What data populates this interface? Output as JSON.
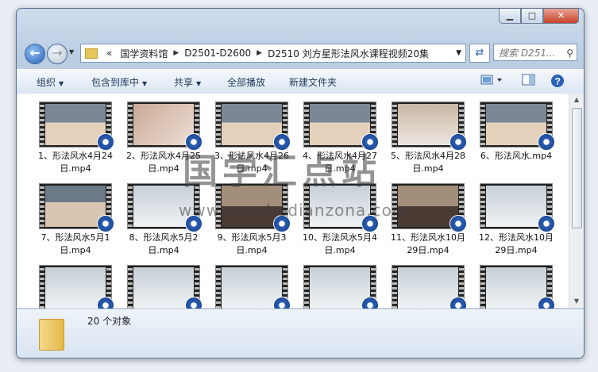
{
  "window": {
    "caption": {
      "minimize": "▁",
      "maximize": "□",
      "close": "✕"
    }
  },
  "address": {
    "prefix": "«",
    "crumbs": [
      "国学资料馆",
      "D2501-D2600",
      "D2510 刘方星形法风水课程视频20集"
    ],
    "search_placeholder": "搜索 D251..."
  },
  "toolbar": {
    "organize": "组织",
    "include_library": "包含到库中",
    "share": "共享",
    "play_all": "全部播放",
    "new_folder": "新建文件夹"
  },
  "files": [
    {
      "name": "1、形法风水4月24日.mp4",
      "thumb": "p-c"
    },
    {
      "name": "2、形法风水4月25日.mp4",
      "thumb": "p-b"
    },
    {
      "name": "3、形法风水4月26日.mp4",
      "thumb": "p-c"
    },
    {
      "name": "4、形法风水4月27日.mp4",
      "thumb": "p-c"
    },
    {
      "name": "5、形法风水4月28日.mp4",
      "thumb": "p-f"
    },
    {
      "name": "6、形法风水.mp4",
      "thumb": "p-c"
    },
    {
      "name": "7、形法风水5月1日.mp4",
      "thumb": "p-a"
    },
    {
      "name": "8、形法风水5月2日.mp4",
      "thumb": "p-d"
    },
    {
      "name": "9、形法风水5月3日.mp4",
      "thumb": "p-e"
    },
    {
      "name": "10、形法风水5月4日.mp4",
      "thumb": "p-d"
    },
    {
      "name": "11、形法风水10月29日.mp4",
      "thumb": "p-e"
    },
    {
      "name": "12、形法风水10月29日.mp4",
      "thumb": "p-d"
    },
    {
      "name": "",
      "thumb": "p-d"
    },
    {
      "name": "",
      "thumb": "p-d"
    },
    {
      "name": "",
      "thumb": "p-d"
    },
    {
      "name": "",
      "thumb": "p-d"
    },
    {
      "name": "",
      "thumb": "p-d"
    },
    {
      "name": "",
      "thumb": "p-d"
    }
  ],
  "status": {
    "count": "20 个对象"
  },
  "watermark": {
    "title": "国学汇点站",
    "url": "www.guoxhedianzona.com"
  }
}
